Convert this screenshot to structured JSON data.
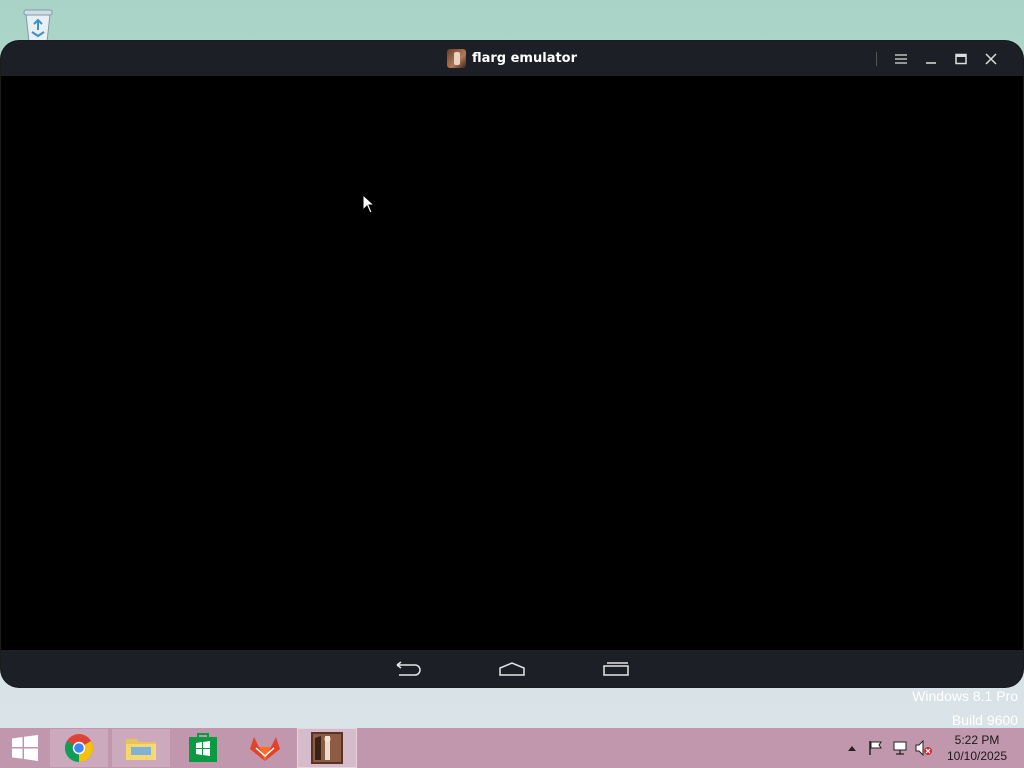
{
  "desktop": {
    "recycle_bin_icon": "recycle-bin-icon",
    "watermark": {
      "line1": "Windows 8.1 Pro",
      "line2": "Build 9600"
    }
  },
  "window": {
    "title": "flarg emulator",
    "icon": "flarg-app-icon",
    "controls": [
      "menu-icon",
      "minimize-icon",
      "maximize-icon",
      "close-icon"
    ],
    "nav_buttons": [
      "back-icon",
      "home-icon",
      "recents-icon"
    ],
    "colors": {
      "titlebar": "#1c1f26",
      "screen": "#000000"
    }
  },
  "taskbar": {
    "color": "#c197ae",
    "items": [
      {
        "name": "chrome",
        "icon": "chrome-icon"
      },
      {
        "name": "file-explorer",
        "icon": "folder-icon"
      },
      {
        "name": "store",
        "icon": "store-icon"
      },
      {
        "name": "gitlab",
        "icon": "fox-icon"
      },
      {
        "name": "flarg-emulator",
        "icon": "flarg-app-icon",
        "active": true
      }
    ],
    "tray": [
      "show-hidden-icon",
      "flag-icon",
      "network-icon",
      "volume-muted-icon"
    ],
    "clock": {
      "time": "5:22 PM",
      "date": "10/10/2025"
    }
  }
}
